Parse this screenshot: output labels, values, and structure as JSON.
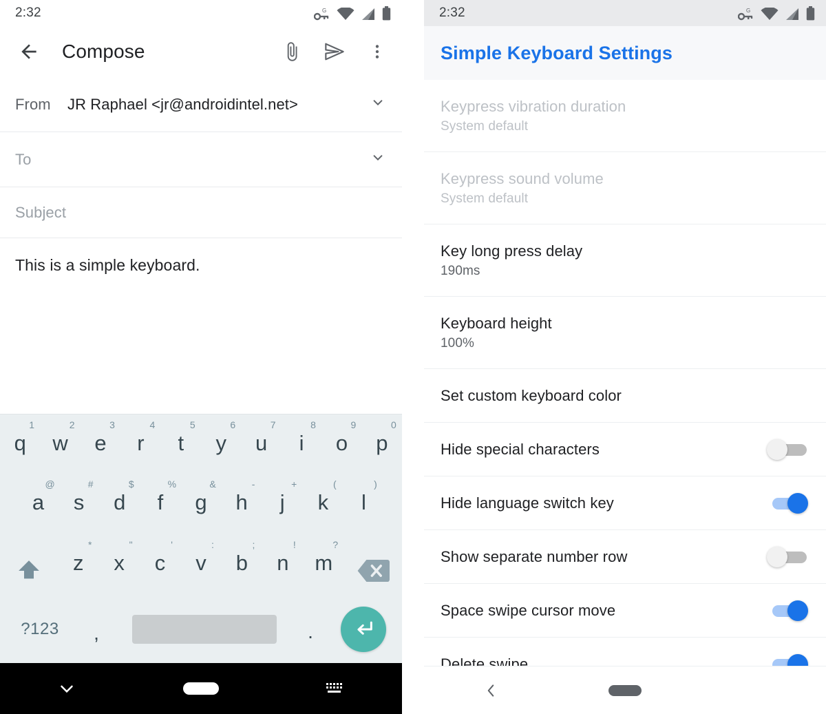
{
  "left_phone": {
    "status_bar": {
      "time": "2:32",
      "icons": [
        "vpn-key-g-icon",
        "wifi-icon",
        "signal-icon",
        "battery-icon"
      ]
    },
    "app_bar": {
      "back_icon": "back-arrow-icon",
      "title": "Compose",
      "actions": [
        {
          "name": "attach-icon",
          "label": "Attach"
        },
        {
          "name": "send-icon",
          "label": "Send"
        },
        {
          "name": "more-options-icon",
          "label": "More options"
        }
      ]
    },
    "fields": {
      "from_label": "From",
      "from_value": "JR Raphael  <jr@androidintel.net>",
      "to_placeholder": "To",
      "subject_placeholder": "Subject",
      "body_text": "This is a simple keyboard."
    },
    "keyboard": {
      "row1": [
        {
          "key": "q",
          "alt": "1"
        },
        {
          "key": "w",
          "alt": "2"
        },
        {
          "key": "e",
          "alt": "3"
        },
        {
          "key": "r",
          "alt": "4"
        },
        {
          "key": "t",
          "alt": "5"
        },
        {
          "key": "y",
          "alt": "6"
        },
        {
          "key": "u",
          "alt": "7"
        },
        {
          "key": "i",
          "alt": "8"
        },
        {
          "key": "o",
          "alt": "9"
        },
        {
          "key": "p",
          "alt": "0"
        }
      ],
      "row2": [
        {
          "key": "a",
          "alt": "@"
        },
        {
          "key": "s",
          "alt": "#"
        },
        {
          "key": "d",
          "alt": "$"
        },
        {
          "key": "f",
          "alt": "%"
        },
        {
          "key": "g",
          "alt": "&"
        },
        {
          "key": "h",
          "alt": "-"
        },
        {
          "key": "j",
          "alt": "+"
        },
        {
          "key": "k",
          "alt": "("
        },
        {
          "key": "l",
          "alt": ")"
        }
      ],
      "row3": [
        {
          "key": "z",
          "alt": "*"
        },
        {
          "key": "x",
          "alt": "\""
        },
        {
          "key": "c",
          "alt": "'"
        },
        {
          "key": "v",
          "alt": ":"
        },
        {
          "key": "b",
          "alt": ";"
        },
        {
          "key": "n",
          "alt": "!"
        },
        {
          "key": "m",
          "alt": "?"
        }
      ],
      "shift_key": "shift-icon",
      "backspace_key": "backspace-icon",
      "symbols_key": "?123",
      "comma_key": ",",
      "period_key": ".",
      "space_key": "",
      "enter_key": "enter-icon",
      "enter_color": "#4db6ac"
    },
    "nav_bar": {
      "items": [
        "hide-keyboard-chevron-icon",
        "home-pill-icon",
        "switch-keyboard-icon"
      ]
    }
  },
  "right_phone": {
    "status_bar": {
      "time": "2:32",
      "icons": [
        "vpn-key-g-icon",
        "wifi-icon",
        "signal-icon",
        "battery-icon"
      ]
    },
    "header": {
      "title": "Simple Keyboard Settings",
      "accent_color": "#1a73e8"
    },
    "settings": [
      {
        "title": "Keypress vibration duration",
        "subtitle": "System default",
        "type": "value",
        "disabled": true
      },
      {
        "title": "Keypress sound volume",
        "subtitle": "System default",
        "type": "value",
        "disabled": true
      },
      {
        "title": "Key long press delay",
        "subtitle": "190ms",
        "type": "value",
        "disabled": false
      },
      {
        "title": "Keyboard height",
        "subtitle": "100%",
        "type": "value",
        "disabled": false
      },
      {
        "title": "Set custom keyboard color",
        "subtitle": "",
        "type": "action",
        "disabled": false
      },
      {
        "title": "Hide special characters",
        "subtitle": "",
        "type": "switch",
        "switch_on": false
      },
      {
        "title": "Hide language switch key",
        "subtitle": "",
        "type": "switch",
        "switch_on": true
      },
      {
        "title": "Show separate number row",
        "subtitle": "",
        "type": "switch",
        "switch_on": false
      },
      {
        "title": "Space swipe cursor move",
        "subtitle": "",
        "type": "switch",
        "switch_on": true
      },
      {
        "title": "Delete swipe",
        "subtitle": "",
        "type": "switch",
        "switch_on": true
      }
    ],
    "nav_bar": {
      "items": [
        "back-chevron-icon",
        "home-pill-icon"
      ]
    }
  }
}
